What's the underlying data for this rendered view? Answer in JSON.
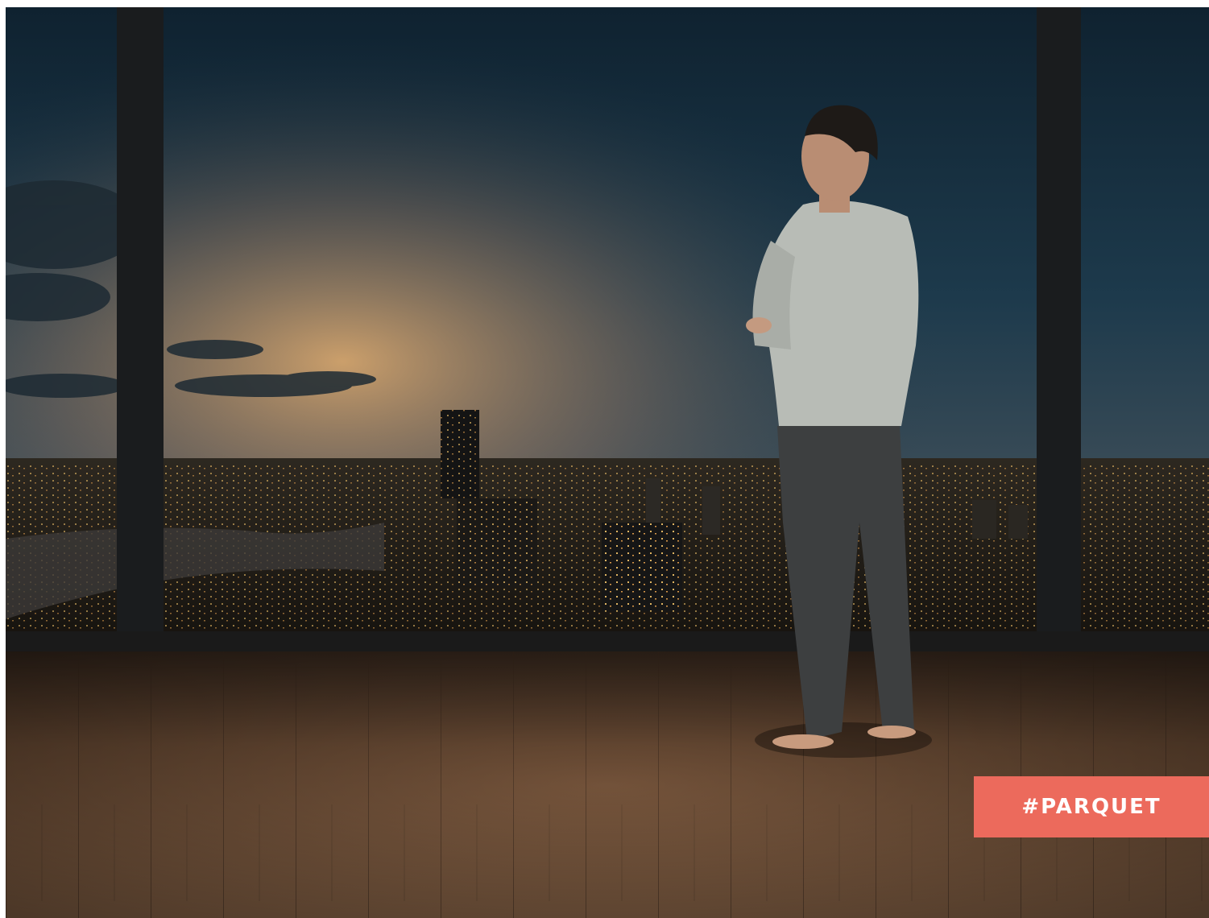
{
  "tag": {
    "label": "#PARQUET",
    "background": "#ec6a5c",
    "text_color": "#ffffff"
  }
}
